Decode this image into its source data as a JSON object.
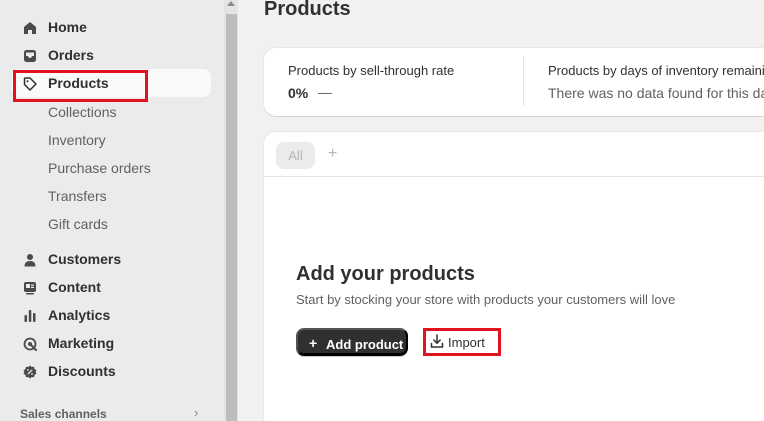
{
  "sidebar": {
    "nav_main": [
      {
        "label": "Home",
        "icon": "home-icon"
      },
      {
        "label": "Orders",
        "icon": "inbox-icon"
      },
      {
        "label": "Products",
        "icon": "tag-icon",
        "active": true
      }
    ],
    "product_subnav": [
      "Collections",
      "Inventory",
      "Purchase orders",
      "Transfers",
      "Gift cards"
    ],
    "nav_secondary": [
      {
        "label": "Customers",
        "icon": "person-icon"
      },
      {
        "label": "Content",
        "icon": "content-icon"
      },
      {
        "label": "Analytics",
        "icon": "bar-chart-icon"
      },
      {
        "label": "Marketing",
        "icon": "target-icon"
      },
      {
        "label": "Discounts",
        "icon": "discount-icon"
      }
    ],
    "sales_channels_label": "Sales channels"
  },
  "page": {
    "title": "Products",
    "metrics": [
      {
        "title": "Products by sell-through rate",
        "value": "0%",
        "trend": "—"
      },
      {
        "title": "Products by days of inventory remaini",
        "empty_text": "There was no data found for this da"
      }
    ],
    "tabs": {
      "all_label": "All",
      "add_label": "+"
    },
    "empty_state": {
      "heading": "Add your products",
      "subtext": "Start by stocking your store with products your customers will love",
      "add_product_label": "Add product",
      "import_label": "Import"
    }
  },
  "colors": {
    "highlight": "#e0141e",
    "primary_button": "#303030",
    "sidebar_bg": "#ebebeb",
    "page_bg": "#f1f1f1"
  }
}
